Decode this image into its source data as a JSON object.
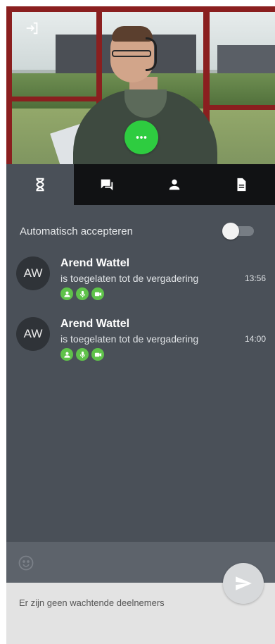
{
  "video": {
    "exit_icon": "exit-icon",
    "more_icon": "more-horizontal-icon",
    "more_button_color": "#2ecc40"
  },
  "tabs": [
    {
      "name": "waiting",
      "icon": "hourglass-icon",
      "active": true
    },
    {
      "name": "chat",
      "icon": "chat-icon",
      "active": false
    },
    {
      "name": "participants",
      "icon": "person-icon",
      "active": false
    },
    {
      "name": "documents",
      "icon": "document-icon",
      "active": false
    }
  ],
  "auto_accept": {
    "label": "Automatisch accepteren",
    "enabled": false
  },
  "entries": [
    {
      "initials": "AW",
      "name": "Arend Wattel",
      "text": "is toegelaten tot de vergadering",
      "time": "13:56",
      "permissions": [
        "person-icon",
        "microphone-icon",
        "camera-icon"
      ]
    },
    {
      "initials": "AW",
      "name": "Arend Wattel",
      "text": "is toegelaten tot de vergadering",
      "time": "14:00",
      "permissions": [
        "person-icon",
        "microphone-icon",
        "camera-icon"
      ]
    }
  ],
  "message_bar": {
    "emoji_icon": "smiley-icon",
    "send_icon": "send-icon"
  },
  "status": {
    "text": "Er zijn geen wachtende deelnemers"
  },
  "colors": {
    "panel": "#4a5058",
    "tabbar": "#111214",
    "permission_green": "#5fc24a"
  }
}
